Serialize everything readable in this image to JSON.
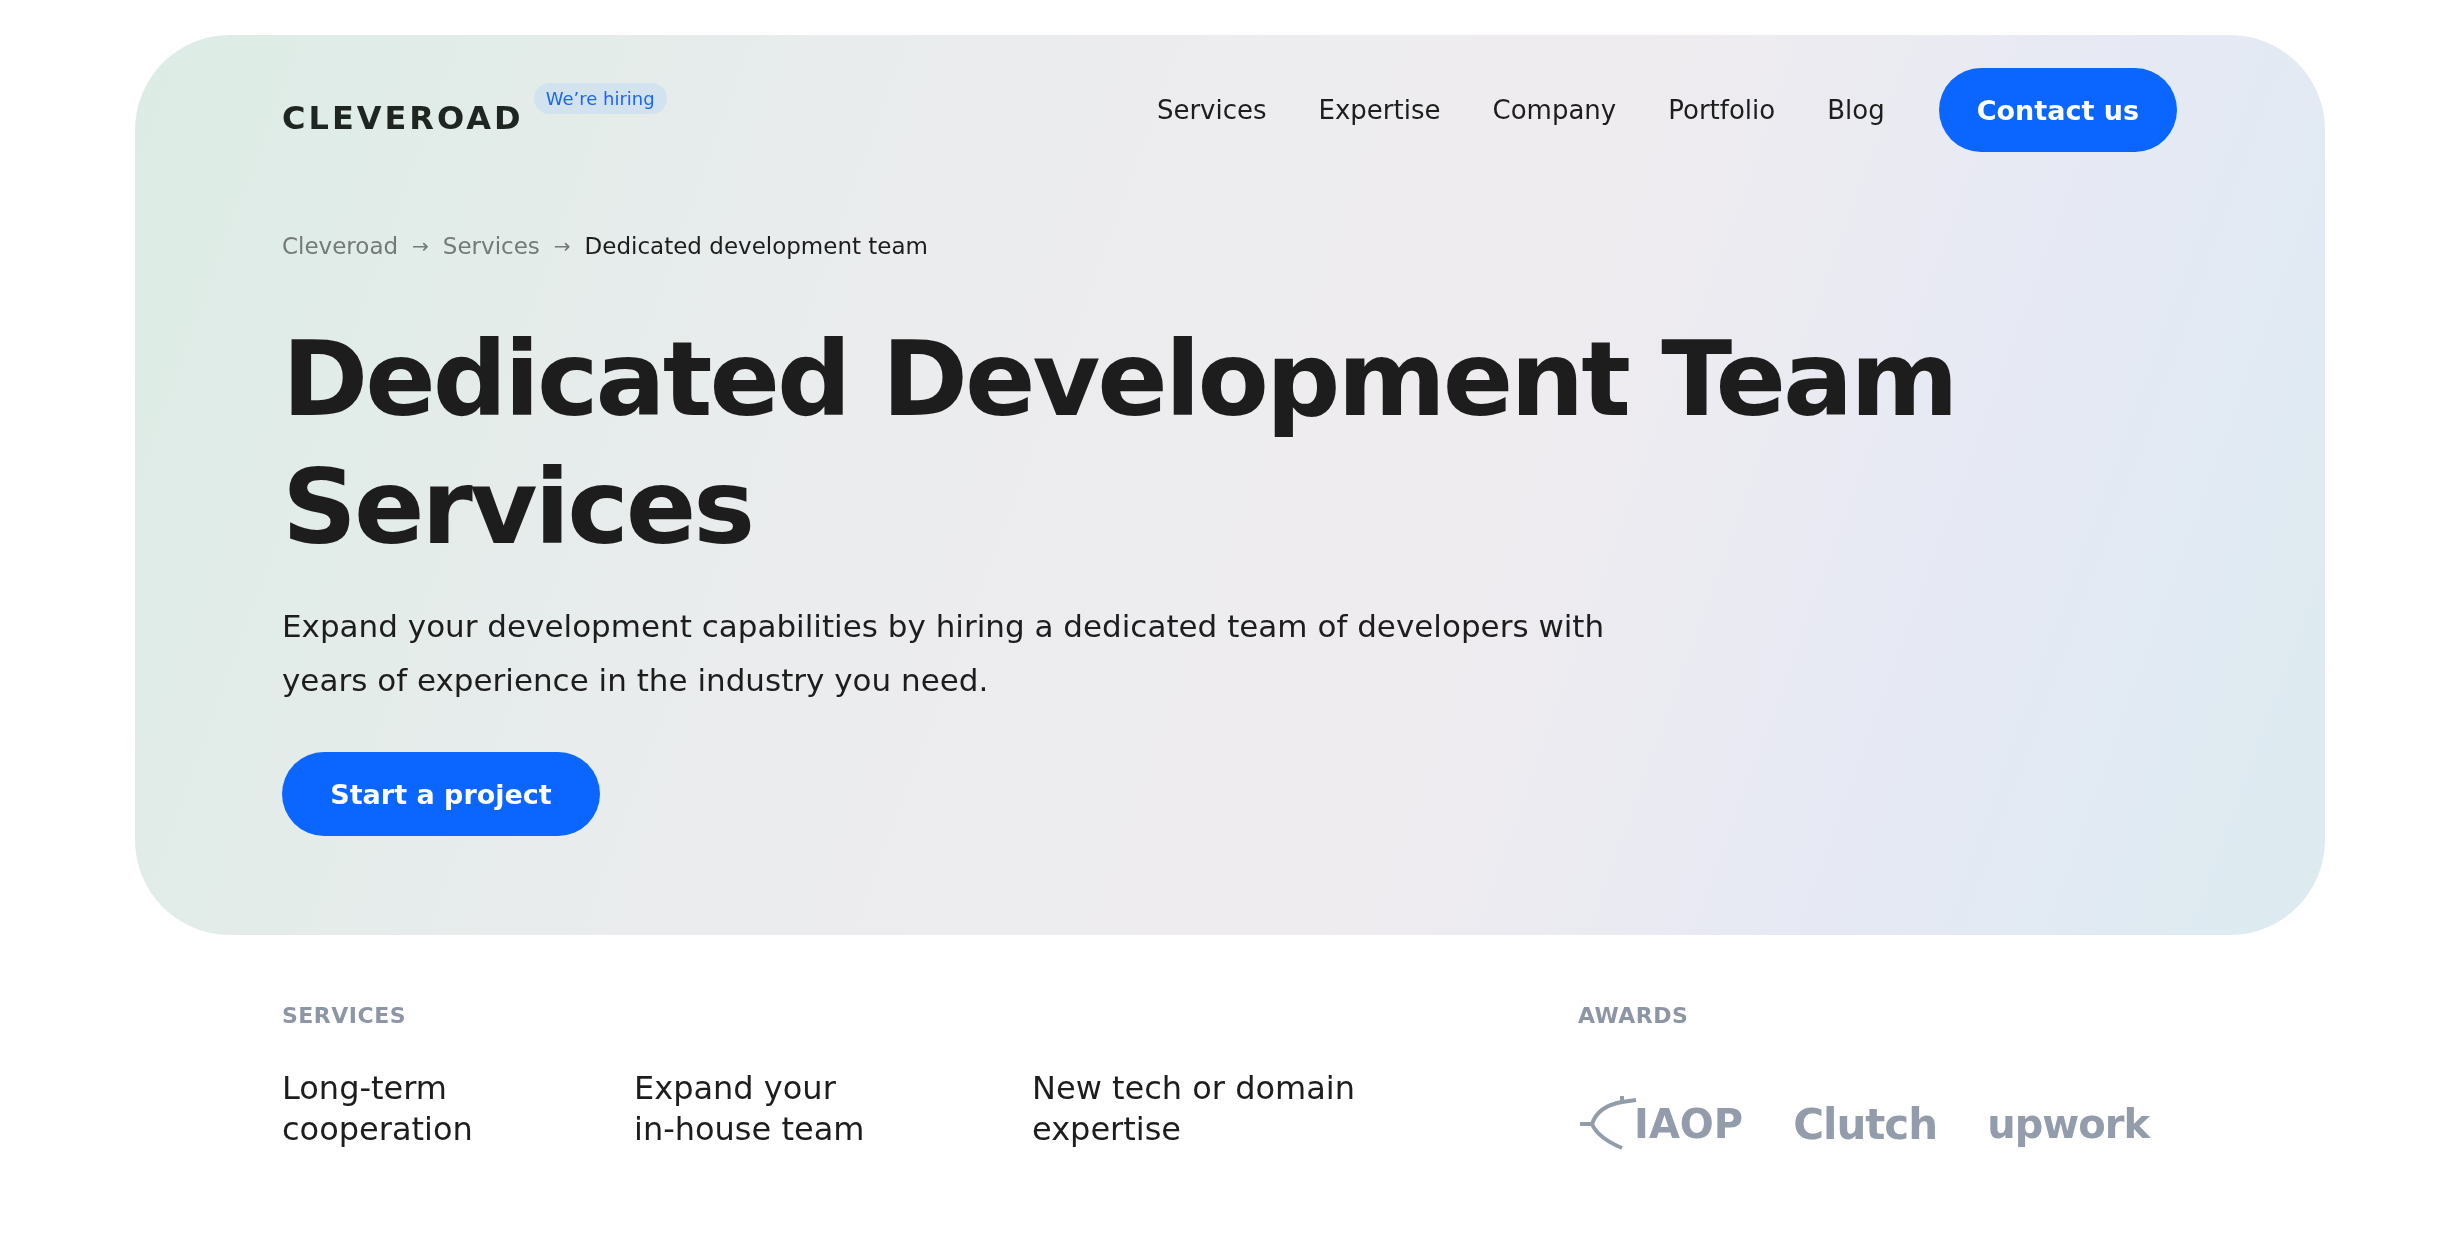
{
  "header": {
    "logo": "CLEVEROAD",
    "hiring_badge": "We’re hiring",
    "nav": [
      {
        "label": "Services"
      },
      {
        "label": "Expertise"
      },
      {
        "label": "Company"
      },
      {
        "label": "Portfolio"
      },
      {
        "label": "Blog"
      }
    ],
    "contact_button": "Contact us"
  },
  "breadcrumbs": [
    {
      "label": "Cleveroad",
      "current": false
    },
    {
      "label": "Services",
      "current": false
    },
    {
      "label": "Dedicated development team",
      "current": true
    }
  ],
  "breadcrumb_separator": "→",
  "hero": {
    "title_lines": [
      "Dedicated Development Team",
      "Services"
    ],
    "description": "Expand your development capabilities by hiring a dedicated team of developers with years of experience in the industry you need.",
    "cta_button": "Start a project"
  },
  "services": {
    "heading": "SERVICES",
    "items": [
      {
        "lines": [
          "Long-term",
          "cooperation"
        ]
      },
      {
        "lines": [
          "Expand your",
          "in-house team"
        ]
      },
      {
        "lines": [
          "New tech or domain",
          "expertise"
        ]
      }
    ]
  },
  "awards": {
    "heading": "AWARDS",
    "logos": [
      {
        "kind": "iaop",
        "text": "IAOP"
      },
      {
        "kind": "clutch",
        "text": "Clutch"
      },
      {
        "kind": "upwork",
        "text": "upwork"
      }
    ]
  }
}
